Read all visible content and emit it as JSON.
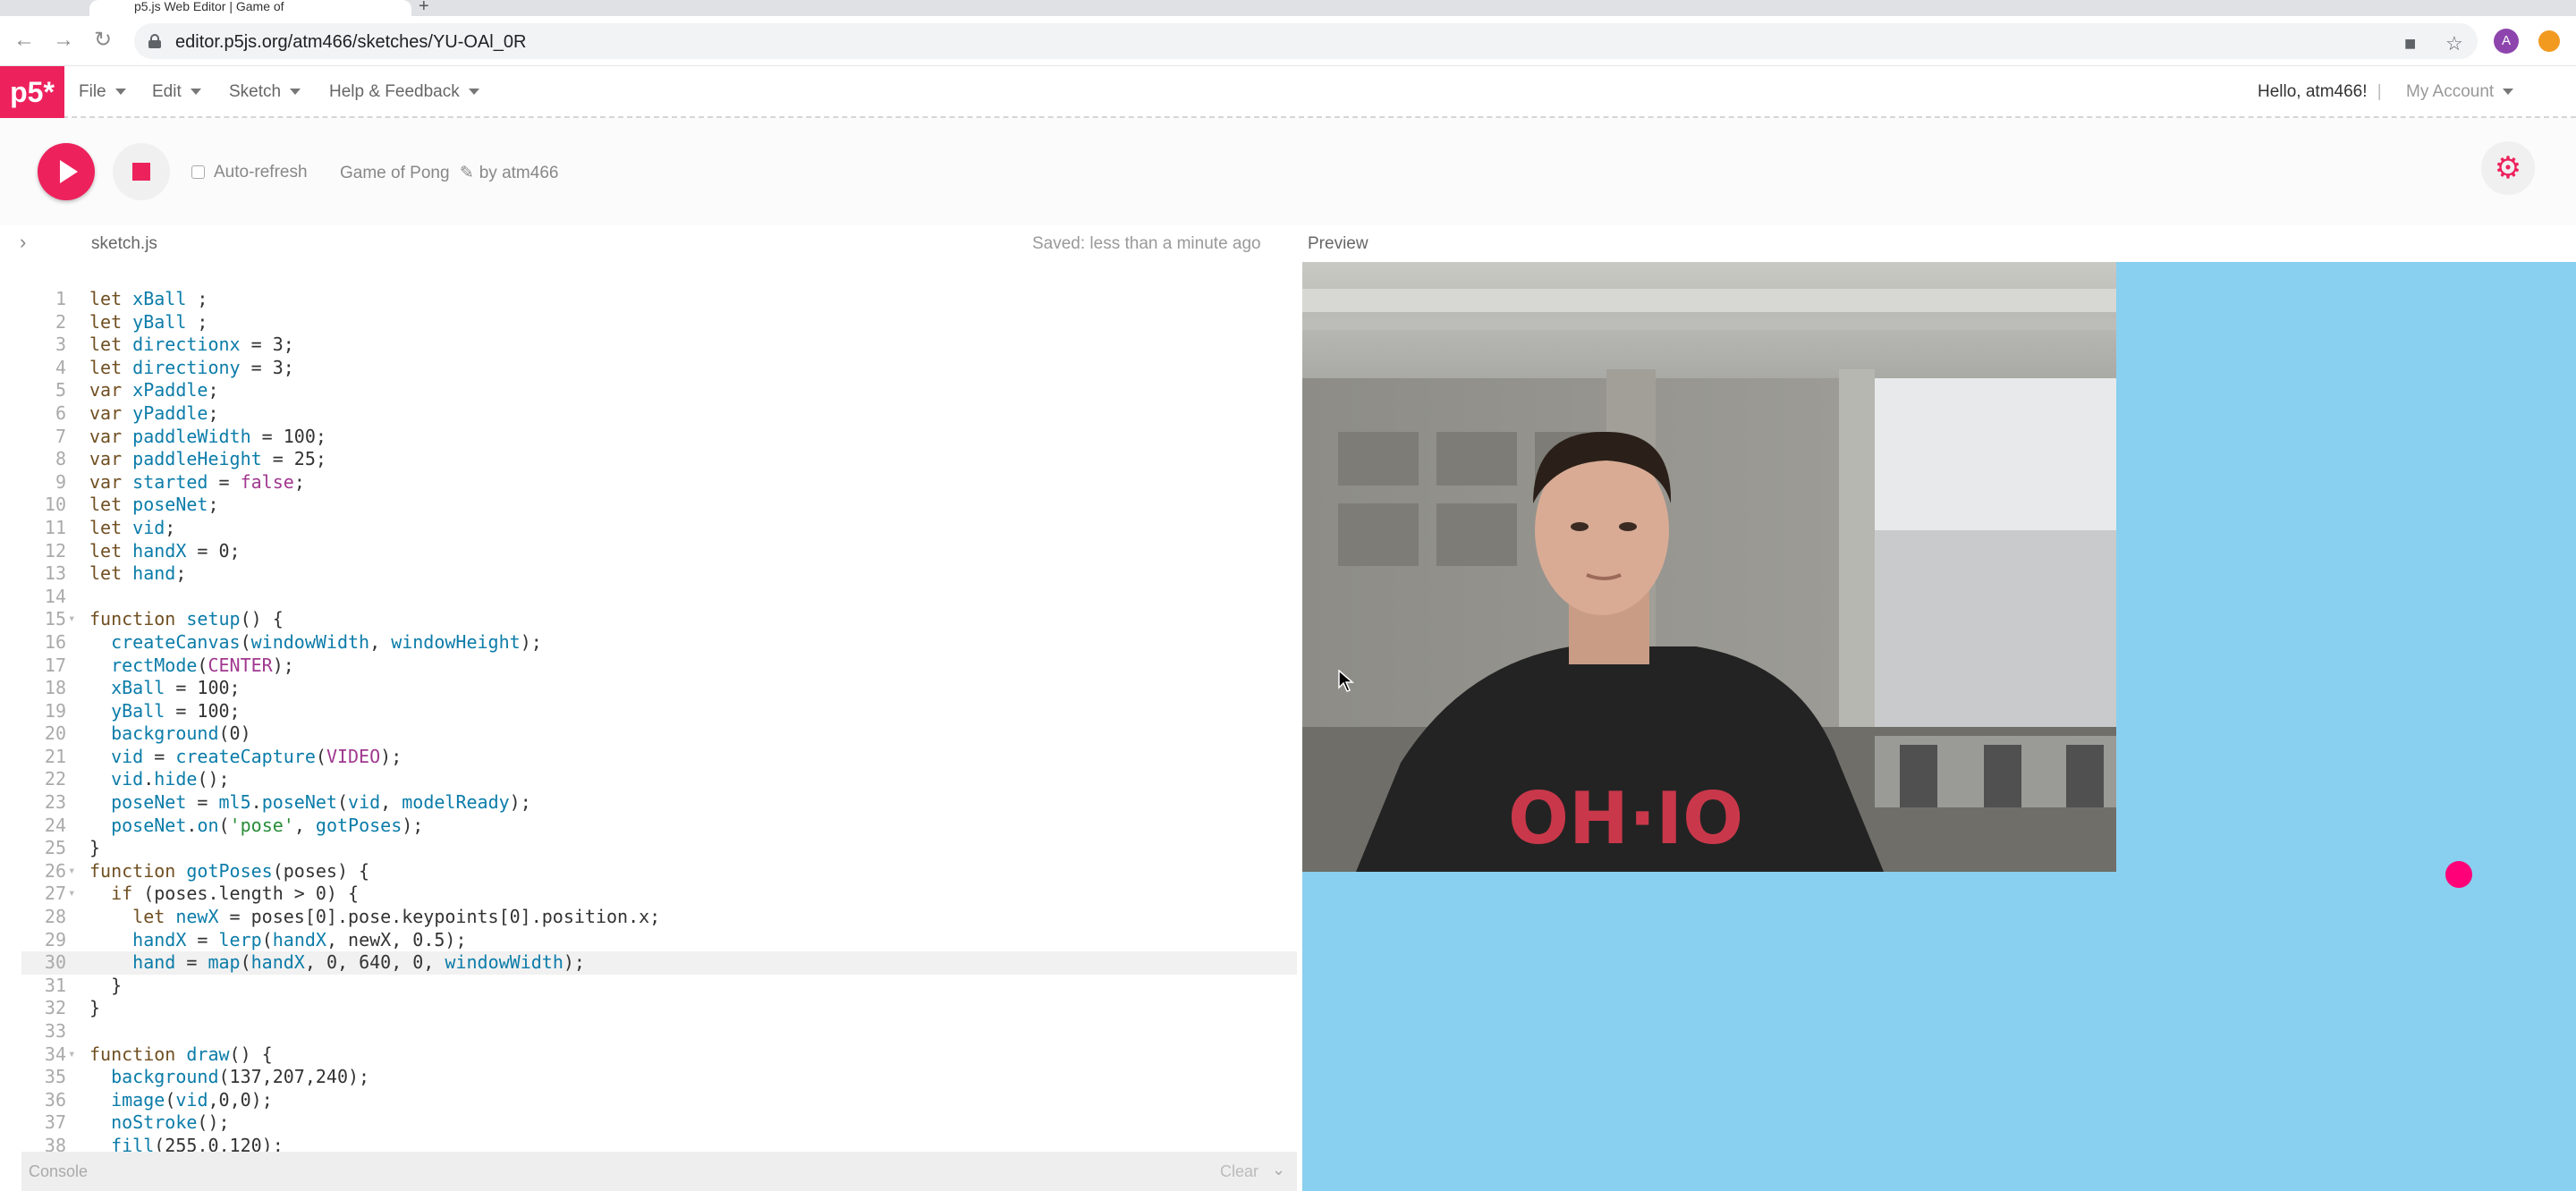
{
  "browser": {
    "tab_title": "p5.js Web Editor | Game of",
    "new_tab": "+",
    "url": "editor.p5js.org/atm466/sketches/YU-OAl_0R",
    "avatar_letter": "A"
  },
  "nav": {
    "logo": "p5*",
    "menus": [
      "File",
      "Edit",
      "Sketch",
      "Help & Feedback"
    ],
    "greeting": "Hello, atm466!",
    "separator": "|",
    "account": "My Account"
  },
  "toolbar": {
    "auto_refresh": "Auto-refresh",
    "sketch_name": "Game of Pong",
    "author": "by atm466"
  },
  "editor": {
    "filename": "sketch.js",
    "saved_status": "Saved: less than a minute ago",
    "preview_label": "Preview",
    "active_line": 30,
    "lines": [
      "let xBall ;",
      "let yBall ;",
      "let directionx = 3;",
      "let directiony = 3;",
      "var xPaddle;",
      "var yPaddle;",
      "var paddleWidth = 100;",
      "var paddleHeight = 25;",
      "var started = false;",
      "let poseNet;",
      "let vid;",
      "let handX = 0;",
      "let hand;",
      "",
      "function setup() {",
      "  createCanvas(windowWidth, windowHeight);",
      "  rectMode(CENTER);",
      "  xBall = 100;",
      "  yBall = 100;",
      "  background(0)",
      "  vid = createCapture(VIDEO);",
      "  vid.hide();",
      "  poseNet = ml5.poseNet(vid, modelReady);",
      "  poseNet.on('pose', gotPoses);",
      "}",
      "function gotPoses(poses) {",
      "  if (poses.length > 0) {",
      "    let newX = poses[0].pose.keypoints[0].position.x;",
      "    handX = lerp(handX, newX, 0.5);",
      "    hand = map(handX, 0, 640, 0, windowWidth);",
      "  }",
      "}",
      "",
      "function draw() {",
      "  background(137,207,240);",
      "  image(vid,0,0);",
      "  noStroke();",
      "  fill(255,0,120);"
    ]
  },
  "console": {
    "label": "Console",
    "clear": "Clear"
  },
  "colors": {
    "p5_pink": "#ed225d",
    "canvas_bg": "#89cff0",
    "ball": "#ff0078"
  }
}
